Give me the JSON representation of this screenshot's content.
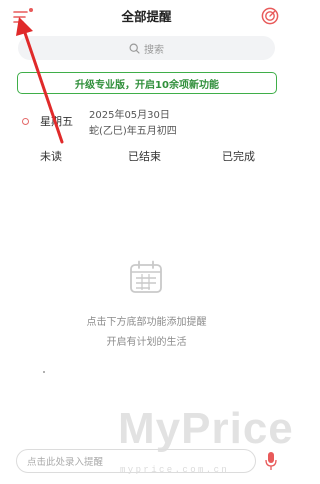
{
  "header": {
    "title": "全部提醒",
    "menu_icon": "menu-icon",
    "right_icon": "target-icon",
    "accent_color": "#e85a5a"
  },
  "search": {
    "placeholder": "搜索"
  },
  "promo": {
    "text": "升级专业版，开启10余项新功能",
    "color": "#3fae49"
  },
  "day": {
    "weekday": "星期五",
    "solar_date": "2025年05月30日",
    "lunar_date": "蛇(乙巳)年五月初四"
  },
  "tabs": [
    {
      "label": "未读"
    },
    {
      "label": "已结束"
    },
    {
      "label": "已完成"
    }
  ],
  "empty_state": {
    "icon": "calendar-icon",
    "line1": "点击下方底部功能添加提醒",
    "line2": "开启有计划的生活"
  },
  "quick_input": {
    "placeholder": "点击此处录入提醒",
    "mic_icon": "microphone-icon"
  },
  "watermark": {
    "big": "MyPrice",
    "small": "myprice.com.cn"
  }
}
